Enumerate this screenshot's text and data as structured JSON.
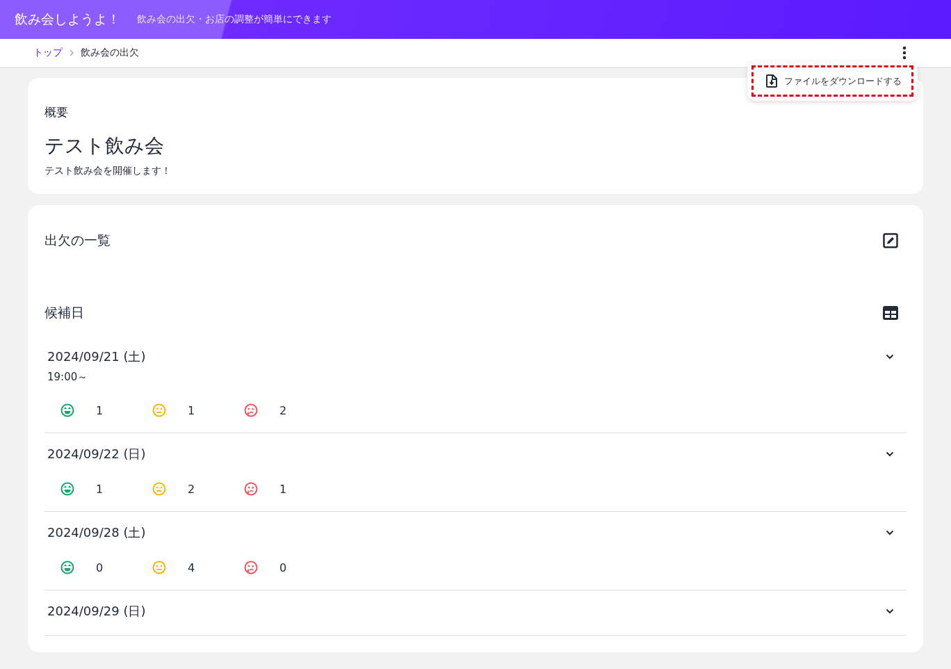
{
  "header": {
    "title": "飲み会しようよ！",
    "tagline": "飲み会の出欠・お店の調整が簡単にできます"
  },
  "breadcrumb": [
    {
      "label": "トップ",
      "kind": "link"
    },
    {
      "label": "飲み会の出欠",
      "kind": "current"
    }
  ],
  "menu": {
    "open": true,
    "items": [
      {
        "label": "ファイルをダウンロードする",
        "highlighted": true
      }
    ]
  },
  "overview": {
    "heading": "概要",
    "title": "テスト飲み会",
    "description": "テスト飲み会を開催します！"
  },
  "attendance": {
    "heading": "出欠の一覧",
    "candidates_heading": "候補日",
    "dates": [
      {
        "date": "2024/09/21 (土)",
        "time": "19:00～",
        "expanded": false,
        "counts": [
          {
            "kind": "yes",
            "value": "1"
          },
          {
            "kind": "maybe",
            "value": "1"
          },
          {
            "kind": "no",
            "value": "2"
          }
        ]
      },
      {
        "date": "2024/09/22 (日)",
        "expanded": false,
        "counts": [
          {
            "kind": "yes",
            "value": "1"
          },
          {
            "kind": "maybe",
            "value": "2"
          },
          {
            "kind": "no",
            "value": "1"
          }
        ]
      },
      {
        "date": "2024/09/28 (土)",
        "expanded": false,
        "counts": [
          {
            "kind": "yes",
            "value": "0"
          },
          {
            "kind": "maybe",
            "value": "4"
          },
          {
            "kind": "no",
            "value": "0"
          }
        ]
      },
      {
        "date": "2024/09/29 (日)",
        "expanded": false
      }
    ]
  }
}
